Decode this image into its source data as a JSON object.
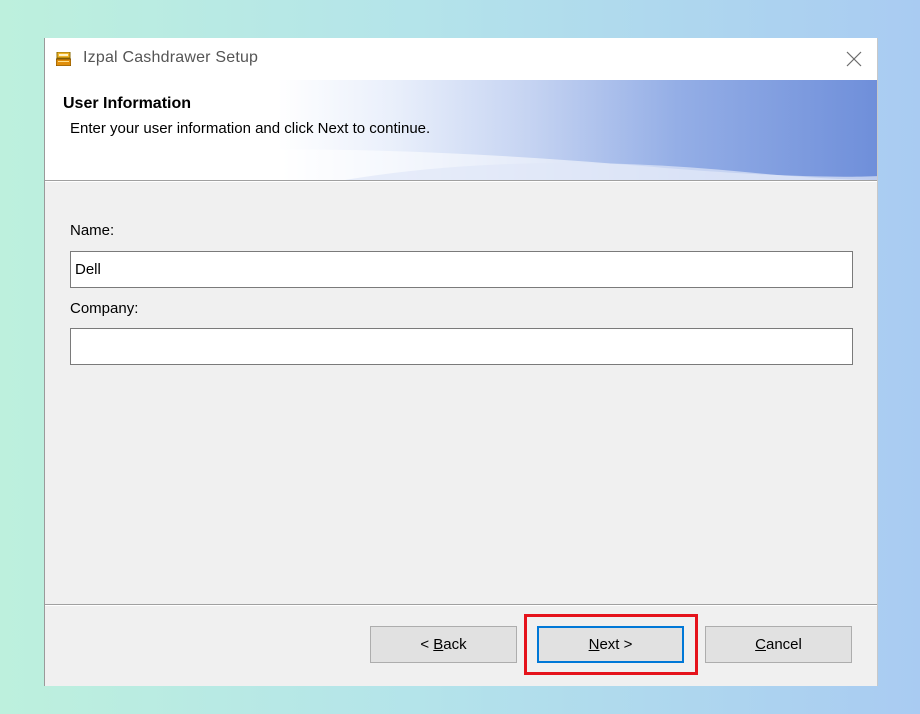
{
  "window": {
    "title": "Izpal Cashdrawer Setup",
    "app_icon": "cash-register-icon",
    "close_icon": "close-icon"
  },
  "banner": {
    "title": "User Information",
    "subtitle": "Enter your user information and click Next to continue."
  },
  "form": {
    "name_label": "Name:",
    "name_value": "Dell",
    "company_label": "Company:",
    "company_value": ""
  },
  "buttons": {
    "back": {
      "prefix": "< ",
      "mnemonic": "B",
      "rest": "ack"
    },
    "next": {
      "prefix": "",
      "mnemonic": "N",
      "rest": "ext >"
    },
    "cancel": {
      "prefix": "",
      "mnemonic": "C",
      "rest": "ancel"
    }
  },
  "colors": {
    "highlight": "#e5131b",
    "focus_border": "#0078d7",
    "banner_accent": "#6f8fda"
  }
}
